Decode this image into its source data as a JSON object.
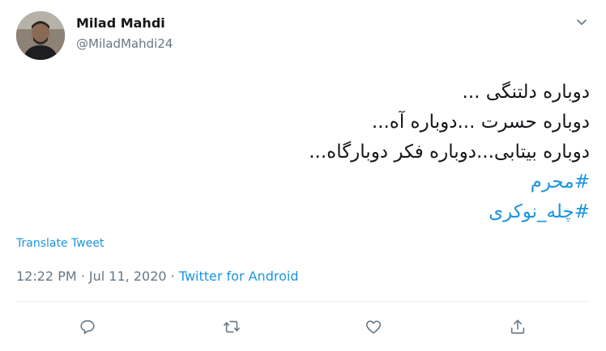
{
  "author": {
    "name": "Milad Mahdi",
    "handle": "@MiladMahdi24"
  },
  "tweet": {
    "lines": [
      "دوباره دلتنگی ...",
      "دوباره حسرت ...دوباره آه...",
      "دوباره بیتابی...دوباره فکر دوبارگاه..."
    ],
    "hashtags": [
      "#محرم",
      "#چله_نوکری"
    ],
    "translate_label": "Translate Tweet",
    "timestamp": "12:22 PM · Jul 11, 2020",
    "separator": " · ",
    "source": "Twitter for Android"
  },
  "icons": {
    "caret": "chevron-down-icon",
    "reply": "reply-icon",
    "retweet": "retweet-icon",
    "like": "heart-icon",
    "share": "share-icon"
  },
  "colors": {
    "text": "#14171a",
    "secondary": "#657786",
    "link": "#1b95e0",
    "divider": "#e6ecf0"
  }
}
